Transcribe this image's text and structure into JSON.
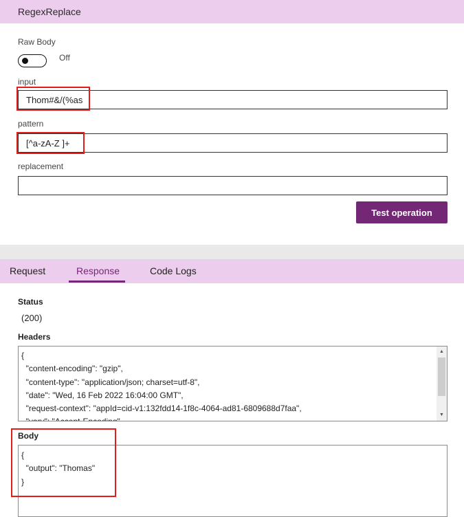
{
  "operation": {
    "title": "RegexReplace"
  },
  "raw_body": {
    "label": "Raw Body",
    "state_label": "Off"
  },
  "input": {
    "label": "input",
    "value": "Thom#&/(%as"
  },
  "pattern": {
    "label": "pattern",
    "value": "[^a-zA-Z ]+"
  },
  "replacement": {
    "label": "replacement",
    "value": ""
  },
  "test_button": {
    "label": "Test operation"
  },
  "tabs": [
    {
      "label": "Request"
    },
    {
      "label": "Response"
    },
    {
      "label": "Code Logs"
    }
  ],
  "response": {
    "status_label": "Status",
    "status_value": "(200)",
    "headers_label": "Headers",
    "headers_lines": [
      "{",
      "  \"content-encoding\": \"gzip\",",
      "  \"content-type\": \"application/json; charset=utf-8\",",
      "  \"date\": \"Wed, 16 Feb 2022 16:04:00 GMT\",",
      "  \"request-context\": \"appId=cid-v1:132fdd14-1f8c-4064-ad81-6809688d7faa\",",
      "  \"vary\": \"Accept-Encoding\""
    ],
    "body_label": "Body",
    "body_lines": [
      "{",
      "  \"output\": \"Thomas\"",
      "}"
    ]
  },
  "colors": {
    "accent": "#742774",
    "header_bg": "#edcdee",
    "highlight": "#e21b1b"
  }
}
